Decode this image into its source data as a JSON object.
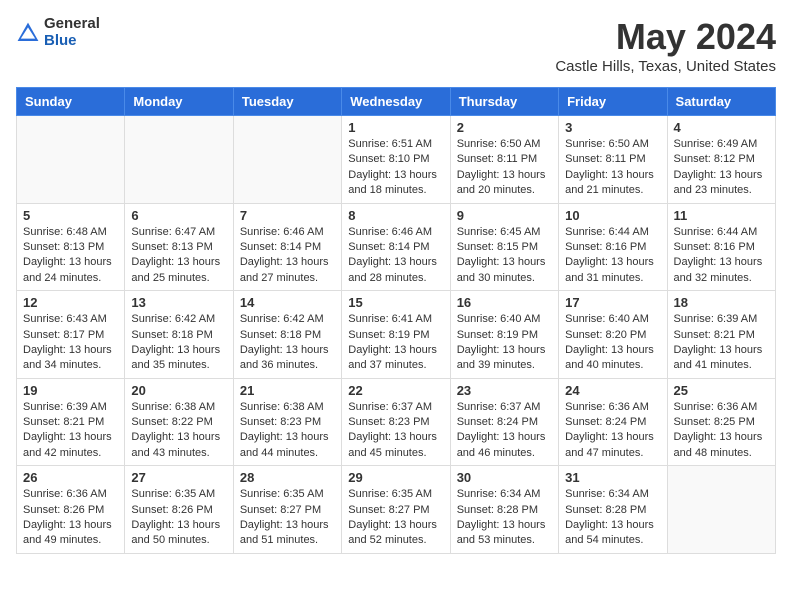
{
  "header": {
    "logo_general": "General",
    "logo_blue": "Blue",
    "main_title": "May 2024",
    "subtitle": "Castle Hills, Texas, United States"
  },
  "calendar": {
    "days_of_week": [
      "Sunday",
      "Monday",
      "Tuesday",
      "Wednesday",
      "Thursday",
      "Friday",
      "Saturday"
    ],
    "weeks": [
      [
        {
          "day": "",
          "info": ""
        },
        {
          "day": "",
          "info": ""
        },
        {
          "day": "",
          "info": ""
        },
        {
          "day": "1",
          "info": "Sunrise: 6:51 AM\nSunset: 8:10 PM\nDaylight: 13 hours and 18 minutes."
        },
        {
          "day": "2",
          "info": "Sunrise: 6:50 AM\nSunset: 8:11 PM\nDaylight: 13 hours and 20 minutes."
        },
        {
          "day": "3",
          "info": "Sunrise: 6:50 AM\nSunset: 8:11 PM\nDaylight: 13 hours and 21 minutes."
        },
        {
          "day": "4",
          "info": "Sunrise: 6:49 AM\nSunset: 8:12 PM\nDaylight: 13 hours and 23 minutes."
        }
      ],
      [
        {
          "day": "5",
          "info": "Sunrise: 6:48 AM\nSunset: 8:13 PM\nDaylight: 13 hours and 24 minutes."
        },
        {
          "day": "6",
          "info": "Sunrise: 6:47 AM\nSunset: 8:13 PM\nDaylight: 13 hours and 25 minutes."
        },
        {
          "day": "7",
          "info": "Sunrise: 6:46 AM\nSunset: 8:14 PM\nDaylight: 13 hours and 27 minutes."
        },
        {
          "day": "8",
          "info": "Sunrise: 6:46 AM\nSunset: 8:14 PM\nDaylight: 13 hours and 28 minutes."
        },
        {
          "day": "9",
          "info": "Sunrise: 6:45 AM\nSunset: 8:15 PM\nDaylight: 13 hours and 30 minutes."
        },
        {
          "day": "10",
          "info": "Sunrise: 6:44 AM\nSunset: 8:16 PM\nDaylight: 13 hours and 31 minutes."
        },
        {
          "day": "11",
          "info": "Sunrise: 6:44 AM\nSunset: 8:16 PM\nDaylight: 13 hours and 32 minutes."
        }
      ],
      [
        {
          "day": "12",
          "info": "Sunrise: 6:43 AM\nSunset: 8:17 PM\nDaylight: 13 hours and 34 minutes."
        },
        {
          "day": "13",
          "info": "Sunrise: 6:42 AM\nSunset: 8:18 PM\nDaylight: 13 hours and 35 minutes."
        },
        {
          "day": "14",
          "info": "Sunrise: 6:42 AM\nSunset: 8:18 PM\nDaylight: 13 hours and 36 minutes."
        },
        {
          "day": "15",
          "info": "Sunrise: 6:41 AM\nSunset: 8:19 PM\nDaylight: 13 hours and 37 minutes."
        },
        {
          "day": "16",
          "info": "Sunrise: 6:40 AM\nSunset: 8:19 PM\nDaylight: 13 hours and 39 minutes."
        },
        {
          "day": "17",
          "info": "Sunrise: 6:40 AM\nSunset: 8:20 PM\nDaylight: 13 hours and 40 minutes."
        },
        {
          "day": "18",
          "info": "Sunrise: 6:39 AM\nSunset: 8:21 PM\nDaylight: 13 hours and 41 minutes."
        }
      ],
      [
        {
          "day": "19",
          "info": "Sunrise: 6:39 AM\nSunset: 8:21 PM\nDaylight: 13 hours and 42 minutes."
        },
        {
          "day": "20",
          "info": "Sunrise: 6:38 AM\nSunset: 8:22 PM\nDaylight: 13 hours and 43 minutes."
        },
        {
          "day": "21",
          "info": "Sunrise: 6:38 AM\nSunset: 8:23 PM\nDaylight: 13 hours and 44 minutes."
        },
        {
          "day": "22",
          "info": "Sunrise: 6:37 AM\nSunset: 8:23 PM\nDaylight: 13 hours and 45 minutes."
        },
        {
          "day": "23",
          "info": "Sunrise: 6:37 AM\nSunset: 8:24 PM\nDaylight: 13 hours and 46 minutes."
        },
        {
          "day": "24",
          "info": "Sunrise: 6:36 AM\nSunset: 8:24 PM\nDaylight: 13 hours and 47 minutes."
        },
        {
          "day": "25",
          "info": "Sunrise: 6:36 AM\nSunset: 8:25 PM\nDaylight: 13 hours and 48 minutes."
        }
      ],
      [
        {
          "day": "26",
          "info": "Sunrise: 6:36 AM\nSunset: 8:26 PM\nDaylight: 13 hours and 49 minutes."
        },
        {
          "day": "27",
          "info": "Sunrise: 6:35 AM\nSunset: 8:26 PM\nDaylight: 13 hours and 50 minutes."
        },
        {
          "day": "28",
          "info": "Sunrise: 6:35 AM\nSunset: 8:27 PM\nDaylight: 13 hours and 51 minutes."
        },
        {
          "day": "29",
          "info": "Sunrise: 6:35 AM\nSunset: 8:27 PM\nDaylight: 13 hours and 52 minutes."
        },
        {
          "day": "30",
          "info": "Sunrise: 6:34 AM\nSunset: 8:28 PM\nDaylight: 13 hours and 53 minutes."
        },
        {
          "day": "31",
          "info": "Sunrise: 6:34 AM\nSunset: 8:28 PM\nDaylight: 13 hours and 54 minutes."
        },
        {
          "day": "",
          "info": ""
        }
      ]
    ]
  }
}
